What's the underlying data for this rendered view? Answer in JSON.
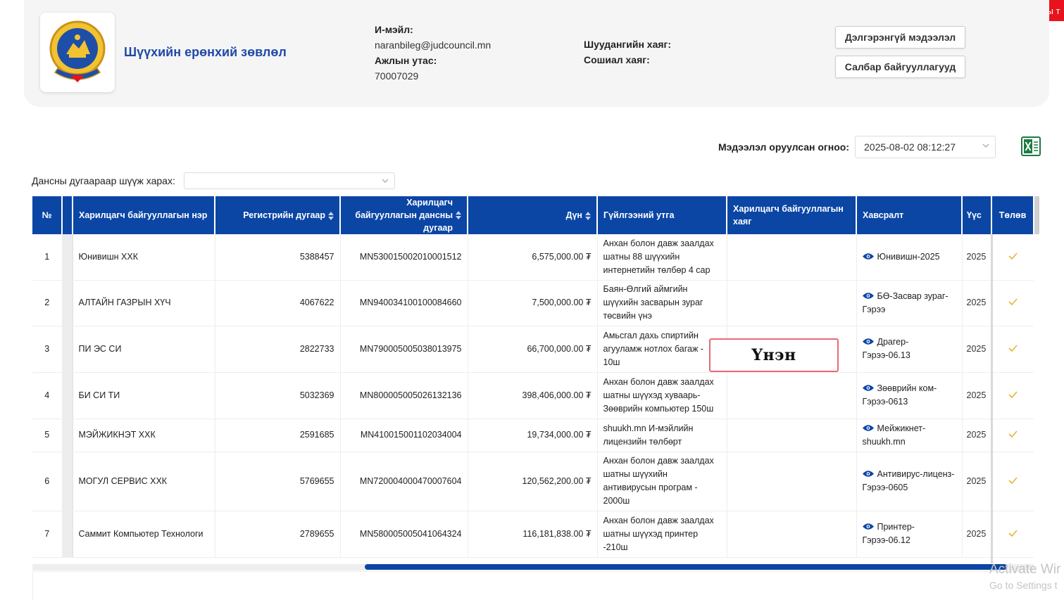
{
  "ribbon": {
    "label": "Нэр томъёоны т"
  },
  "org": {
    "name": "Шүүхийн ерөнхий зөвлөл"
  },
  "contact": {
    "email_label": "И-мэйл:",
    "email_value": "naranbileg@judcouncil.mn",
    "phone_label": "Ажлын утас:",
    "phone_value": "70007029",
    "mail_address_label": "Шуудангийн хаяг:",
    "social_label": "Сошиал хаяг:"
  },
  "buttons": {
    "details": "Дэлгэрэнгүй мэдээлэл",
    "branches": "Салбар байгууллагууд"
  },
  "date_filter": {
    "label": "Мэдээлэл оруулсан огноо:",
    "value": "2025-08-02 08:12:27"
  },
  "account_filter": {
    "label": "Дансны дугаараар шүүж харах:"
  },
  "table": {
    "headers": {
      "no": "№",
      "name": "Харилцагч байгууллагын нэр",
      "reg": "Регистрийн дугаар",
      "account": "Харилцагч байгууллагын дансны дугаар",
      "amount": "Дүн",
      "purpose": "Гүйлгээний утга",
      "address": "Харилцагч байгууллагын хаяг",
      "attachment": "Хавсралт",
      "date": "Үүс",
      "paid": "Төлөв"
    },
    "rows": [
      {
        "no": "1",
        "name": "Юнивишн ХХК",
        "reg": "5388457",
        "account": "MN530015002010001512",
        "amount": "6,575,000.00 ₮",
        "purpose": "Анхан болон давж заалдах шатны 88 шүүхийн интернетийн төлбөр 4 сар",
        "attachment": "Юнивишн-2025",
        "year": "2025"
      },
      {
        "no": "2",
        "name": "АЛТАЙН ГАЗРЫН ХҮЧ",
        "reg": "4067622",
        "account": "MN940034100100084660",
        "amount": "7,500,000.00 ₮",
        "purpose": "Баян-Өлгий аймгийн шүүхийн засварын зураг төсвийн үнэ",
        "attachment": "БӨ-Засвар зураг-Гэрээ",
        "year": "2025"
      },
      {
        "no": "3",
        "name": "ПИ ЭС СИ",
        "reg": "2822733",
        "account": "MN790005005038013975",
        "amount": "66,700,000.00 ₮",
        "purpose": "Амьсгал дахь спиртийн агууламж нотлох багаж - 10ш",
        "attachment": "Драгер-Гэрээ-06.13",
        "year": "2025"
      },
      {
        "no": "4",
        "name": "БИ СИ ТИ",
        "reg": "5032369",
        "account": "MN800005005026132136",
        "amount": "398,406,000.00 ₮",
        "purpose": "Анхан болон давж заалдах шатны шүүхэд хуваарь-Зөөврийн компьютер 150ш",
        "attachment": "Зөөврийн ком-Гэрээ-0613",
        "year": "2025"
      },
      {
        "no": "5",
        "name": "МЭЙЖИКНЭТ ХХК",
        "reg": "2591685",
        "account": "MN410015001102034004",
        "amount": "19,734,000.00 ₮",
        "purpose": "shuukh.mn И-мэйлийн лицензийн төлбөрт",
        "attachment": "Мейжикнет-shuukh.mn",
        "year": "2025"
      },
      {
        "no": "6",
        "name": "МОГУЛ СЕРВИС ХХК",
        "reg": "5769655",
        "account": "MN720004000470007604",
        "amount": "120,562,200.00 ₮",
        "purpose": "Анхан болон давж заалдах шатны шүүхийн антивирусын програм - 2000ш",
        "attachment": "Антивирус-лиценз-Гэрээ-0605",
        "year": "2025"
      },
      {
        "no": "7",
        "name": "Саммит Компьютер Технологи",
        "reg": "2789655",
        "account": "MN580005005041064324",
        "amount": "116,181,838.00 ₮",
        "purpose": "Анхан болон давж заалдах шатны шүүхэд принтер -210ш",
        "attachment": "Принтер-Гэрээ-06.12",
        "year": "2025"
      }
    ]
  },
  "watermark": {
    "text": "Үнэн"
  },
  "os": {
    "activate_line1": "Activate Wir",
    "activate_line2": "Go to Settings t"
  },
  "icons": {
    "eye": "eye-icon",
    "check": "check-icon",
    "excel": "excel-icon",
    "bookmark": "bookmark-icon"
  },
  "colors": {
    "header_blue": "#0b46a5",
    "title_blue": "#1f4aa8",
    "ribbon_red": "#e8121d",
    "check_gold": "#e8b23a"
  }
}
